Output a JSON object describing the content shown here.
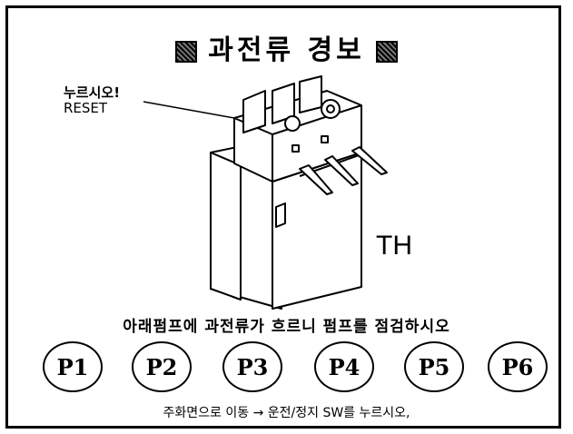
{
  "title": "과전류 경보",
  "reset_hint": {
    "line1": "누르시오!",
    "line2": "RESET"
  },
  "device_label": "TH",
  "instruction": "아래펌프에 과전류가 흐르니 펌프를 점검하시오",
  "pumps": [
    "P1",
    "P2",
    "P3",
    "P4",
    "P5",
    "P6"
  ],
  "footer": "주화면으로 이동 → 운전/정지 SW를 누르시오,"
}
